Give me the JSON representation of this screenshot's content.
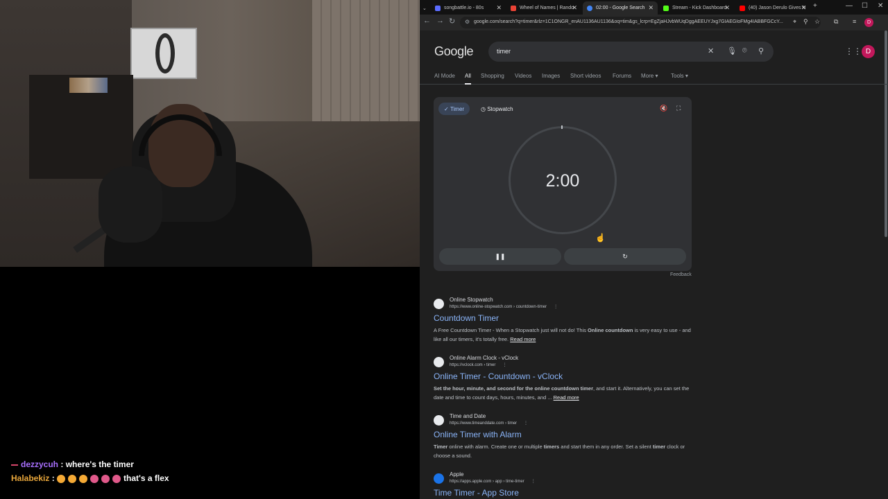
{
  "chat": {
    "messages": [
      {
        "user": "dezzycuh",
        "separator": " : ",
        "text": "where's the timer"
      },
      {
        "user": "Halabekiz",
        "separator": " : ",
        "text": "that's a flex"
      }
    ]
  },
  "browser": {
    "tabs": [
      {
        "title": "songbattle.io - 80s",
        "color": "#5b6cff"
      },
      {
        "title": "Wheel of Names | Rando",
        "color": "#ea4335"
      },
      {
        "title": "02:00 - Google Search",
        "color": "#4285f4"
      },
      {
        "title": "Stream - Kick Dashboard",
        "color": "#53fc18"
      },
      {
        "title": "(40) Jason Derulo Gives N",
        "color": "#ff0000"
      }
    ],
    "url": "google.com/search?q=timer&rlz=1C1ONGR_enAU1136AU1136&oq=tim&gs_lcrp=EgZjaHJvbWUqDggAEEUYJxg7GIAEGIoFMg4IABBFGCcY...",
    "profile_letter": "D"
  },
  "google": {
    "logo": "Google",
    "query": "timer",
    "tabs": [
      "AI Mode",
      "All",
      "Shopping",
      "Videos",
      "Images",
      "Short videos",
      "Forums",
      "More ▾",
      "Tools ▾"
    ],
    "active_tab": "All",
    "avatar_letter": "D",
    "timer_widget": {
      "mode_timer": "Timer",
      "mode_stopwatch": "Stopwatch",
      "time": "2:00",
      "feedback": "Feedback"
    },
    "results": [
      {
        "site": "Online Stopwatch",
        "url": "https://www.online-stopwatch.com › countdown-timer",
        "title": "Countdown Timer",
        "snippet_html": "A Free Countdown Timer - When a Stopwatch just will not do! This <b>Online countdown</b> is very easy to use - and like all our timers, it's totally free.",
        "more": "Read more"
      },
      {
        "site": "Online Alarm Clock - vClock",
        "url": "https://vclock.com › timer",
        "title": "Online Timer - Countdown - vClock",
        "snippet_html": "<b>Set the hour, minute, and second for the online countdown timer</b>, and start it. Alternatively, you can set the date and time to count days, hours, minutes, and ...",
        "more": "Read more"
      },
      {
        "site": "Time and Date",
        "url": "https://www.timeanddate.com › timer",
        "title": "Online Timer with Alarm",
        "snippet_html": "<b>Timer</b> online with alarm. Create one or multiple <b>timers</b> and start them in any order. Set a silent <b>timer</b> clock or choose a sound.",
        "more": ""
      },
      {
        "site": "Apple",
        "url": "https://apps.apple.com › app › time-timer",
        "title": "Time Timer - App Store",
        "snippet_html": "",
        "more": ""
      }
    ]
  }
}
